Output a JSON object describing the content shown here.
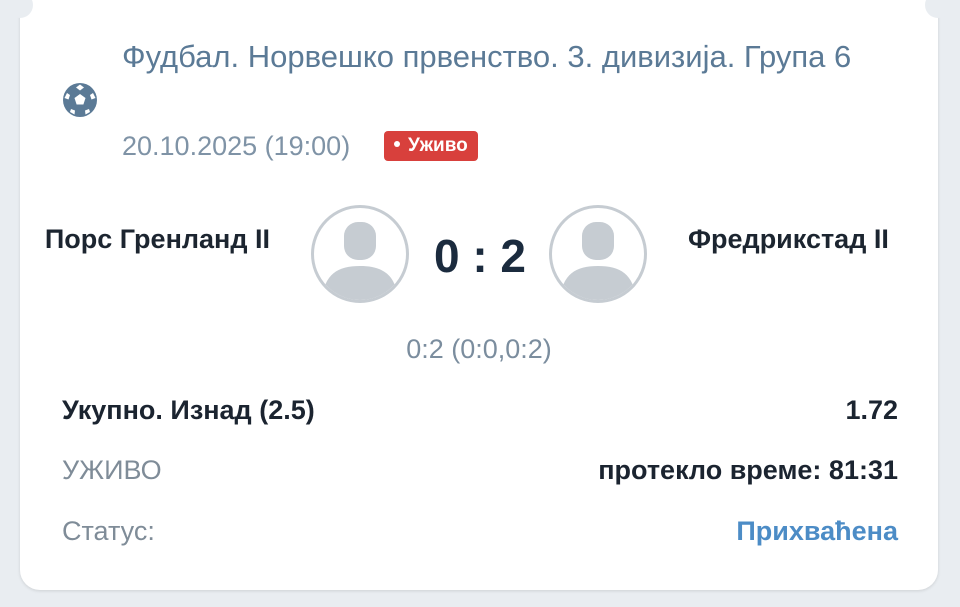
{
  "league": {
    "title": "Фудбал. Норвешко првенство. 3. дивизија. Група 6",
    "icon": "football-icon"
  },
  "match": {
    "datetime": "20.10.2025 (19:00)",
    "live_badge": "Уживо",
    "home_team": "Порс Гренланд II",
    "away_team": "Фредрикстад II",
    "score": "0 : 2",
    "score_detail": "0:2 (0:0,0:2)"
  },
  "bet": {
    "market": "Укупно. Изнад (2.5)",
    "odds": "1.72"
  },
  "live": {
    "label": "УЖИВО",
    "elapsed": "протекло време: 81:31"
  },
  "status": {
    "label": "Статус:",
    "value": "Прихваћена"
  },
  "colors": {
    "accent": "#4c8cc6",
    "live_red": "#d8403c",
    "league_text": "#5b7a96"
  }
}
